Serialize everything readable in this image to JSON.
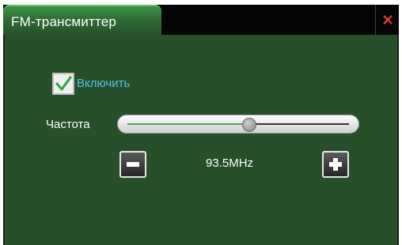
{
  "window": {
    "title": "FM-трансмиттер",
    "close_icon": "close-icon"
  },
  "options": {
    "enable_label": "Включить",
    "enable_checked": true
  },
  "frequency": {
    "label": "Частота",
    "value_text": "93.5MHz",
    "slider_level": 0.55,
    "minus_icon": "minus-icon",
    "plus_icon": "plus-icon"
  },
  "colors": {
    "panel_bg": "#264f2a",
    "accent_green": "#45a84d",
    "label_cyan": "#4ec3e6",
    "close_red": "#e53935"
  }
}
